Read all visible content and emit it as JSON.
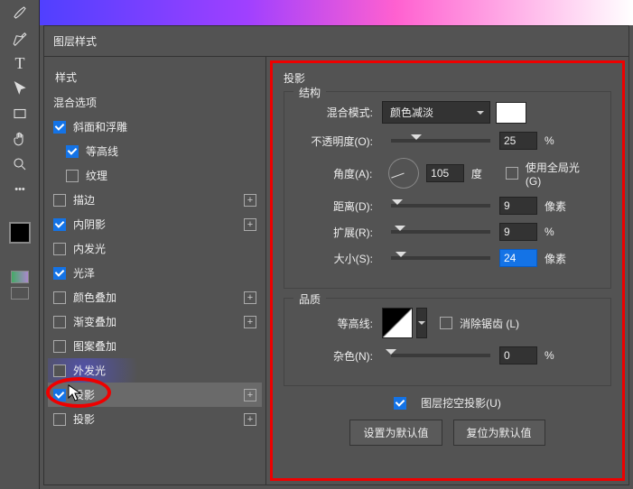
{
  "toolbar_icons": [
    "brush",
    "pen",
    "text",
    "pointer",
    "rect",
    "hand",
    "zoom",
    "more"
  ],
  "modal": {
    "title": "图层样式"
  },
  "styles": {
    "header": "样式",
    "blend_options": "混合选项",
    "items": [
      {
        "label": "斜面和浮雕",
        "checked": true,
        "plus": false,
        "sub": false
      },
      {
        "label": "等高线",
        "checked": true,
        "plus": false,
        "sub": true
      },
      {
        "label": "纹理",
        "checked": false,
        "plus": false,
        "sub": true
      },
      {
        "label": "描边",
        "checked": false,
        "plus": true,
        "sub": false
      },
      {
        "label": "内阴影",
        "checked": true,
        "plus": true,
        "sub": false
      },
      {
        "label": "内发光",
        "checked": false,
        "plus": false,
        "sub": false
      },
      {
        "label": "光泽",
        "checked": true,
        "plus": false,
        "sub": false
      },
      {
        "label": "颜色叠加",
        "checked": false,
        "plus": true,
        "sub": false
      },
      {
        "label": "渐变叠加",
        "checked": false,
        "plus": true,
        "sub": false
      },
      {
        "label": "图案叠加",
        "checked": false,
        "plus": false,
        "sub": false
      },
      {
        "label": "外发光",
        "checked": false,
        "plus": false,
        "sub": false,
        "highlight": true
      },
      {
        "label": "投影",
        "checked": true,
        "plus": true,
        "sub": false,
        "selected": true,
        "circled": true
      },
      {
        "label": "投影",
        "checked": false,
        "plus": true,
        "sub": false
      }
    ]
  },
  "panel": {
    "title": "投影",
    "structure": {
      "legend": "结构",
      "blend_mode_label": "混合模式:",
      "blend_mode_value": "颜色减淡",
      "opacity_label": "不透明度(O):",
      "opacity_value": "25",
      "opacity_unit": "%",
      "angle_label": "角度(A):",
      "angle_value": "105",
      "angle_unit": "度",
      "global_light_label": "使用全局光 (G)",
      "distance_label": "距离(D):",
      "distance_value": "9",
      "distance_unit": "像素",
      "spread_label": "扩展(R):",
      "spread_value": "9",
      "spread_unit": "%",
      "size_label": "大小(S):",
      "size_value": "24",
      "size_unit": "像素"
    },
    "quality": {
      "legend": "品质",
      "contour_label": "等高线:",
      "antialias_label": "消除锯齿 (L)",
      "noise_label": "杂色(N):",
      "noise_value": "0",
      "noise_unit": "%"
    },
    "knockout_label": "图层挖空投影(U)",
    "set_default": "设置为默认值",
    "reset_default": "复位为默认值"
  }
}
